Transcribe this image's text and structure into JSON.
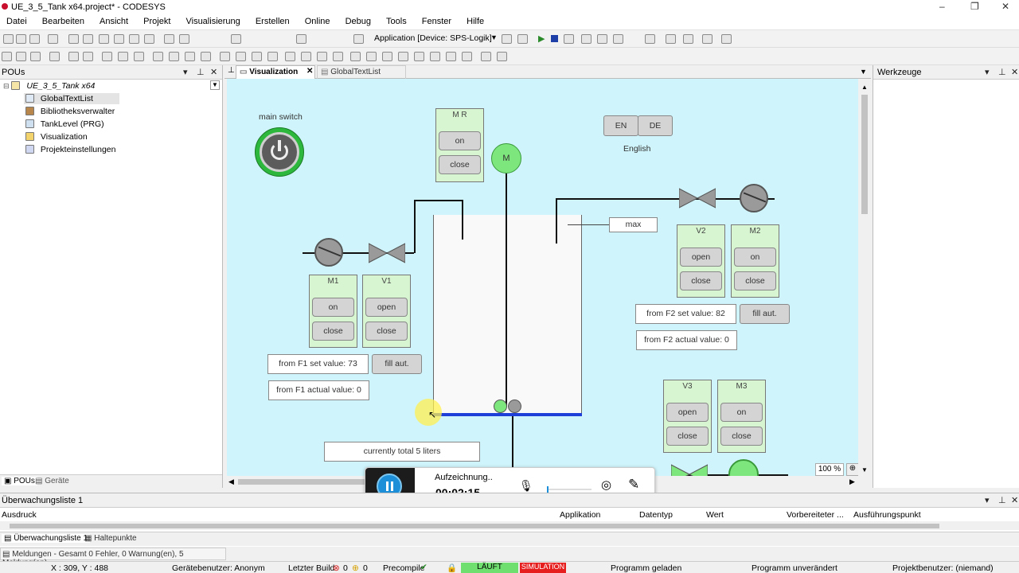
{
  "title": "UE_3_5_Tank x64.project* - CODESYS",
  "menu": [
    "Datei",
    "Bearbeiten",
    "Ansicht",
    "Projekt",
    "Visualisierung",
    "Erstellen",
    "Online",
    "Debug",
    "Tools",
    "Fenster",
    "Hilfe"
  ],
  "toolbar": {
    "app_label": "Application [Device: SPS-Logik]"
  },
  "pous_panel": {
    "title": "POUs",
    "root": "UE_3_5_Tank x64",
    "items": [
      "GlobalTextList",
      "Bibliotheksverwalter",
      "TankLevel (PRG)",
      "Visualization",
      "Projekteinstellungen"
    ],
    "bottom_tabs": [
      "POUs",
      "Geräte"
    ]
  },
  "editor_tabs": [
    "Visualization",
    "GlobalTextList"
  ],
  "tools_panel": {
    "title": "Werkzeuge"
  },
  "vis": {
    "main_switch": "main switch",
    "lang_en": "EN",
    "lang_de": "DE",
    "lang_current": "English",
    "mr": {
      "label": "M R",
      "on": "on",
      "close": "close"
    },
    "motor": "M",
    "max": "max",
    "m1": {
      "label": "M1",
      "on": "on",
      "close": "close"
    },
    "v1": {
      "label": "V1",
      "open": "open",
      "close": "close"
    },
    "v2": {
      "label": "V2",
      "open": "open",
      "close": "close"
    },
    "m2": {
      "label": "M2",
      "on": "on",
      "close": "close"
    },
    "v3": {
      "label": "V3",
      "open": "open",
      "close": "close"
    },
    "m3": {
      "label": "M3",
      "on": "on",
      "close": "close"
    },
    "f1_set": "from F1 set value: 73",
    "f1_actual": "from F1 actual value: 0",
    "f1_fill": "fill aut.",
    "f2_set": "from F2 set value: 82",
    "f2_actual": "from F2 actual value: 0",
    "f2_fill": "fill aut.",
    "total": "currently total 5 liters",
    "zoom": "100 %"
  },
  "recorder": {
    "status": "Aufzeichnung..",
    "time": "00:02:15"
  },
  "watch": {
    "title": "Überwachungsliste 1",
    "columns": [
      "Ausdruck",
      "Applikation",
      "Datentyp",
      "Wert",
      "Vorbereiteter ...",
      "Ausführungspunkt"
    ],
    "tabs": [
      "Überwachungsliste 1",
      "Haltepunkte"
    ]
  },
  "messages": "Meldungen - Gesamt 0 Fehler, 0 Warnung(en), 5 Meldung(en)",
  "status": {
    "coords": "X : 309, Y : 488",
    "user": "Gerätebenutzer: Anonym",
    "build": "Letzter Build",
    "err": "0",
    "warn": "0",
    "precompile": "Precompile",
    "run": "LÄUFT",
    "sim": "SIMULATION",
    "loaded": "Programm geladen",
    "unchanged": "Programm unverändert",
    "proj_user": "Projektbenutzer: (niemand)"
  }
}
